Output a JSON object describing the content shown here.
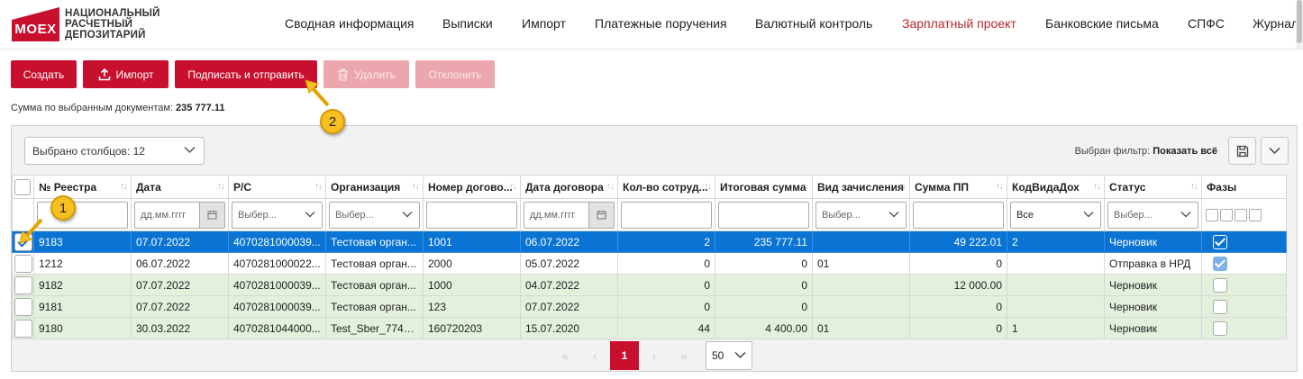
{
  "logo": {
    "mark": "MOEX",
    "line1": "НАЦИОНАЛЬНЫЙ",
    "line2": "РАСЧЕТНЫЙ",
    "line3": "ДЕПОЗИТАРИЙ"
  },
  "nav": [
    {
      "label": "Сводная информация",
      "active": false
    },
    {
      "label": "Выписки",
      "active": false
    },
    {
      "label": "Импорт",
      "active": false
    },
    {
      "label": "Платежные поручения",
      "active": false
    },
    {
      "label": "Валютный контроль",
      "active": false
    },
    {
      "label": "Зарплатный проект",
      "active": true
    },
    {
      "label": "Банковские письма",
      "active": false
    },
    {
      "label": "СПФС",
      "active": false
    },
    {
      "label": "Журнал",
      "active": false
    }
  ],
  "toolbar": {
    "create": "Создать",
    "import": "Импорт",
    "sign_send": "Подписать и отправить",
    "delete": "Удалить",
    "reject": "Отклонить"
  },
  "summary": {
    "label": "Сумма по выбранным документам:",
    "value": "235 777.11"
  },
  "grid": {
    "columns_selected": "Выбрано столбцов: 12",
    "filter_label": "Выбран фильтр:",
    "filter_value": "Показать всё",
    "headers": [
      "№ Реестра",
      "Дата",
      "Р/С",
      "Организация",
      "Номер догово...",
      "Дата договора",
      "Кол-во сотруд...",
      "Итоговая сумма",
      "Вид зачисления",
      "Сумма ПП",
      "КодВидаДох",
      "Статус",
      "Фазы"
    ],
    "filters": {
      "date_placeholder": "дд.мм.гггг",
      "select_placeholder": "Выбер...",
      "kod_value": "Все"
    },
    "rows": [
      {
        "reestr": "9183",
        "date": "07.07.2022",
        "rs": "4070281000039...",
        "org": "Тестовая орган...",
        "contract_no": "1001",
        "contract_date": "06.07.2022",
        "employees": "2",
        "total": "235 777.11",
        "credit_type": "",
        "sum_pp": "49 222.01",
        "kod": "2",
        "status": "Черновик"
      },
      {
        "reestr": "1212",
        "date": "06.07.2022",
        "rs": "4070281000022...",
        "org": "Тестовая орган...",
        "contract_no": "2000",
        "contract_date": "05.07.2022",
        "employees": "0",
        "total": "0",
        "credit_type": "01",
        "sum_pp": "0",
        "kod": "",
        "status": "Отправка в НРД"
      },
      {
        "reestr": "9182",
        "date": "07.07.2022",
        "rs": "4070281000039...",
        "org": "Тестовая орган...",
        "contract_no": "1000",
        "contract_date": "04.07.2022",
        "employees": "0",
        "total": "0",
        "credit_type": "",
        "sum_pp": "12 000.00",
        "kod": "",
        "status": "Черновик"
      },
      {
        "reestr": "9181",
        "date": "07.07.2022",
        "rs": "4070281000039...",
        "org": "Тестовая орган...",
        "contract_no": "123",
        "contract_date": "07.07.2022",
        "employees": "0",
        "total": "0",
        "credit_type": "",
        "sum_pp": "0",
        "kod": "",
        "status": "Черновик"
      },
      {
        "reestr": "9180",
        "date": "30.03.2022",
        "rs": "4070281044000...",
        "org": "Test_Sber_7746...",
        "contract_no": "160720203",
        "contract_date": "15.07.2020",
        "employees": "44",
        "total": "4 400.00",
        "credit_type": "01",
        "sum_pp": "0",
        "kod": "1",
        "status": "Черновик"
      }
    ]
  },
  "pager": {
    "first": "«",
    "prev": "‹",
    "current": "1",
    "next": "›",
    "last": "»",
    "page_size": "50"
  },
  "annotations": {
    "badge1": "1",
    "badge2": "2"
  },
  "colors": {
    "brand": "#c8102e",
    "selected_row": "#0a74d4",
    "green_row": "#e2f0dc",
    "annotation": "#f6c023"
  }
}
